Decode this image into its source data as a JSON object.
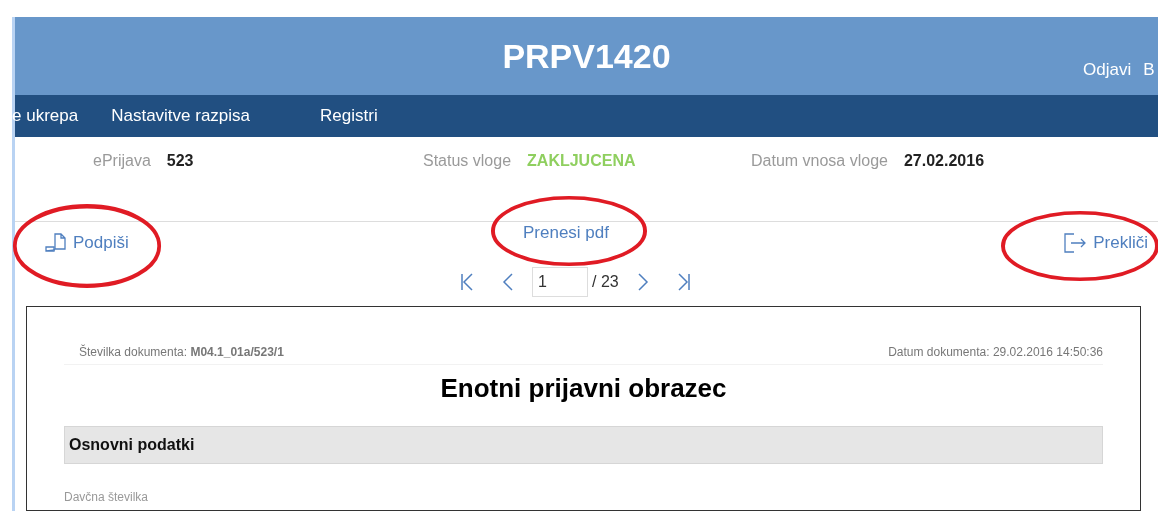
{
  "header": {
    "title": "PRPV1420",
    "links": [
      "Odjavi",
      "B"
    ]
  },
  "nav": [
    "e ukrepa",
    "Nastavitve razpisa",
    "Registri"
  ],
  "info": [
    {
      "label": "ePrijava",
      "value": "523",
      "kind": "plain"
    },
    {
      "label": "Status vloge",
      "value": "ZAKLJUCENA",
      "kind": "status"
    },
    {
      "label": "Datum vnosa vloge",
      "value": "27.02.2016",
      "kind": "plain"
    }
  ],
  "actions": {
    "sign": "Podpiši",
    "download": "Prenesi pdf",
    "cancel": "Prekliči"
  },
  "pager": {
    "page": "1",
    "total": "/ 23"
  },
  "document": {
    "number_label": "Številka dokumenta: **M04.1_01a/523/1**",
    "date": "Datum dokumenta: 29.02.2016 14:50:36",
    "title": "Enotni prijavni obrazec",
    "section": "Osnovni podatki",
    "field_label": "Davčna številka"
  }
}
